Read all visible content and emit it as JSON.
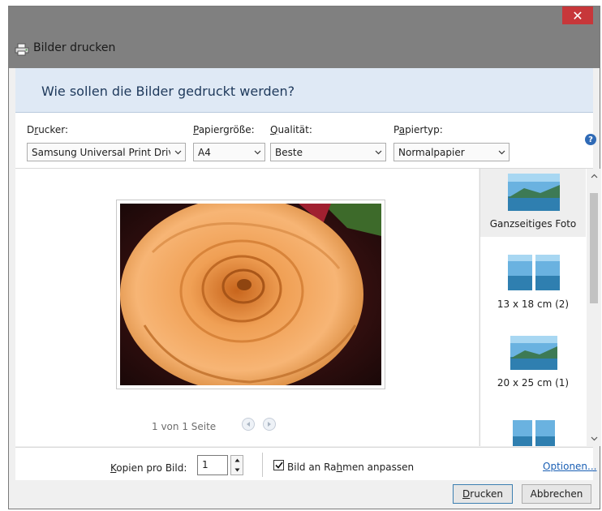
{
  "window": {
    "title": "Bilder drucken",
    "close_glyph": "✕",
    "icon": "printer-icon"
  },
  "heading": "Wie sollen die Bilder gedruckt werden?",
  "fields": {
    "printer": {
      "label_pre": "D",
      "label_acc": "r",
      "label_post": "ucker:",
      "value": "Samsung Universal Print Driver"
    },
    "paper_size": {
      "label_pre": "",
      "label_acc": "P",
      "label_post": "apiergröße:",
      "value": "A4"
    },
    "quality": {
      "label_pre": "",
      "label_acc": "Q",
      "label_post": "ualität:",
      "value": "Beste"
    },
    "paper_type": {
      "label_pre": "P",
      "label_acc": "a",
      "label_post": "piertyp:",
      "value": "Normalpapier"
    }
  },
  "help_glyph": "?",
  "preview": {
    "page_info": "1 von 1 Seite"
  },
  "sizes": [
    {
      "label": "Ganzseitiges Foto",
      "selected": true
    },
    {
      "label": "13 x 18 cm (2)",
      "selected": false
    },
    {
      "label": "20 x 25 cm (1)",
      "selected": false
    }
  ],
  "bottom": {
    "copies_label_acc": "K",
    "copies_label_post": "opien pro Bild:",
    "copies_value": "1",
    "fit_pre": "Bild an Ra",
    "fit_acc": "h",
    "fit_post": "men anpassen",
    "fit_checked": true,
    "options_link": "Optionen..."
  },
  "buttons": {
    "print_acc": "D",
    "print_post": "rucken",
    "cancel": "Abbrechen"
  },
  "colors": {
    "accent": "#1a5fb4",
    "close": "#c7373a",
    "heading_band": "#dfe9f5"
  }
}
